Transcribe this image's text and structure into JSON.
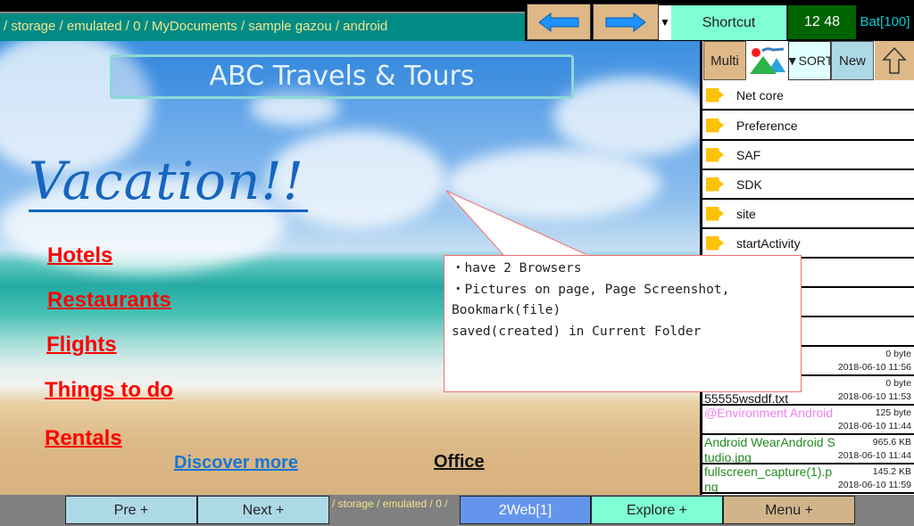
{
  "topbar": {
    "path": "/ storage / emulated / 0 / MyDocuments / sample gazou / android",
    "back_icon": "arrow-left-icon",
    "forward_icon": "arrow-right-icon",
    "dropdown_glyph": "▼",
    "shortcut_label": "Shortcut",
    "clock": "12 48",
    "battery": "Bat[100]",
    "colors": {
      "path_bg": "#008b85",
      "path_text": "#f0e68c",
      "nav_btn": "#deb887",
      "arrow": "#1e90ff",
      "shortcut_bg": "#7fffd4",
      "clock_bg": "#006400",
      "battery_text": "#00ced1"
    }
  },
  "webpage": {
    "site_title": "ABC Travels & Tours",
    "headline": "Vacation!!",
    "links": [
      {
        "label": "Hotels"
      },
      {
        "label": "Restaurants"
      },
      {
        "label": "Flights"
      },
      {
        "label": "Things to do"
      },
      {
        "label": "Rentals"
      }
    ],
    "discover_link": "Discover more",
    "office_link": "Office",
    "colors": {
      "links": "#ff0000",
      "headline": "#1565c0",
      "discover": "#1976d2"
    }
  },
  "tooltip": {
    "lines": [
      "・have 2 Browsers",
      "・Pictures on page, Page Screenshot,",
      "Bookmark(file)",
      "saved(created) in Current Folder"
    ],
    "border_color": "#f07070"
  },
  "file_panel": {
    "toolbar": {
      "multi_label": "Multi",
      "image_icon": "image-icon",
      "sort_label": "▼SORT",
      "new_label": "New",
      "up_icon": "arrow-up-icon"
    },
    "folders": [
      {
        "name": "Net core"
      },
      {
        "name": "Preference"
      },
      {
        "name": "SAF"
      },
      {
        "name": "SDK"
      },
      {
        "name": "site"
      },
      {
        "name": "startActivity"
      }
    ],
    "files": [
      {
        "name": "",
        "size": "0 byte",
        "date": "2018-06-10 11:56",
        "color": "#111111"
      },
      {
        "name": "0610\n55555wsddf.txt",
        "size": "0 byte",
        "date": "2018-06-10 11:53",
        "color": "#111111"
      },
      {
        "name": "@Environment Android",
        "size": "125 byte",
        "date": "2018-06-10 11:44",
        "color": "#ee82ee"
      },
      {
        "name": "Android WearAndroid Studio.jpg",
        "size": "965.6 KB",
        "date": "2018-06-10 11:44",
        "color": "#228b22"
      },
      {
        "name": "fullscreen_capture(1).png",
        "size": "145.2 KB",
        "date": "2018-06-10 11:59",
        "color": "#228b22"
      }
    ],
    "folder_color": "#ffc107"
  },
  "bottombar": {
    "pre_label": "Pre +",
    "next_label": "Next +",
    "path": "/ storage / emulated / 0 /",
    "web_label": "2Web[1]",
    "explore_label": "Explore +",
    "menu_label": "Menu +",
    "colors": {
      "pre_next": "#add8e6",
      "web": "#6495ed",
      "explore": "#7fffd4",
      "menu": "#d2b48c"
    }
  }
}
